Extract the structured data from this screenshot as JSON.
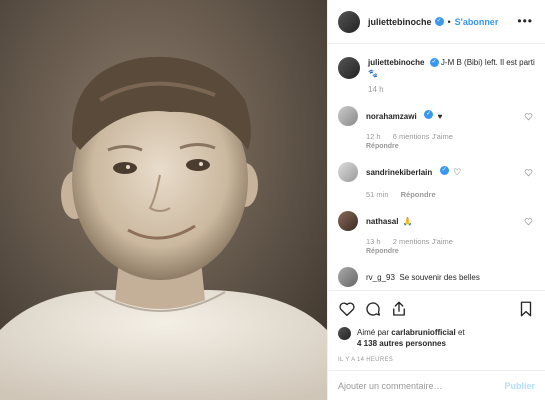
{
  "post": {
    "username": "juliettebinoche",
    "follow_label": "S'abonner",
    "separator": "•",
    "more_label": "•••"
  },
  "caption": {
    "username": "juliettebinoche",
    "text": "J-M B (Bibi) left. Il est parti 🐾",
    "time": "14 h"
  },
  "comments": [
    {
      "username": "norahamzawi",
      "text": "♥",
      "time": "12 h",
      "likes": "6 mentions J'aime",
      "reply": "Répondre"
    },
    {
      "username": "sandrinekiberlain",
      "text": "♡",
      "time": "51 min",
      "likes": "",
      "reply": "Répondre"
    },
    {
      "username": "nathasal",
      "text": "🙏",
      "time": "13 h",
      "likes": "2 mentions J'aime",
      "reply": "Répondre"
    },
    {
      "username": "rv_g_93",
      "text": "Se souvenir des belles",
      "time": "",
      "likes": "",
      "reply": ""
    }
  ],
  "likes": {
    "prefix": "Aimé par",
    "user": "carlabruniofficial",
    "middle": "et",
    "others": "4 138 autres personnes"
  },
  "time_ago": "IL Y A 14 HEURES",
  "add_comment": {
    "placeholder": "Ajouter un commentaire…",
    "post_label": "Publier"
  },
  "colors": {
    "link": "#3897f0",
    "muted": "#999999",
    "post_disabled": "#b2dffc"
  }
}
